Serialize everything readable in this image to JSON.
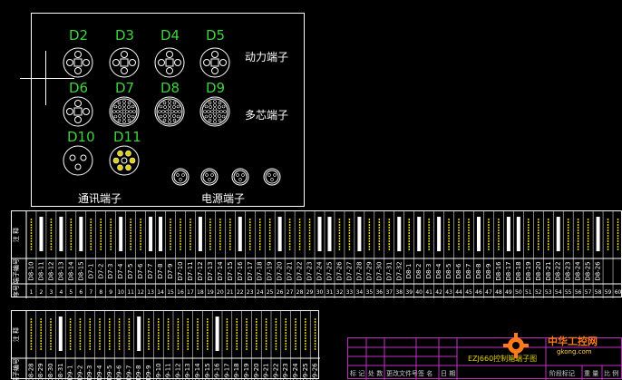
{
  "connectors": {
    "power_group": [
      "D2",
      "D3",
      "D4",
      "D5"
    ],
    "multi_group": [
      "D6",
      "D7",
      "D8",
      "D9"
    ],
    "comm_group": [
      "D10",
      "D11"
    ]
  },
  "labels": {
    "power_terminal": "动力端子",
    "multicore_terminal": "多芯端子",
    "comm_terminal": "通讯端子",
    "power_supply_terminal": "电源端子"
  },
  "strip1": {
    "row_headers": [
      "注 释",
      "端子编号",
      "序号"
    ],
    "first_numbers": [
      "1",
      "2",
      "3",
      "4",
      "5",
      "6",
      "7",
      "8",
      "9",
      "10",
      "11",
      "12",
      "13",
      "14",
      "15",
      "16",
      "17",
      "18",
      "19",
      "20",
      "21",
      "22",
      "23",
      "24",
      "25",
      "26",
      "27",
      "28",
      "29",
      "30",
      "31",
      "32",
      "33",
      "34",
      "35",
      "36",
      "37",
      "38",
      "39",
      "40",
      "41",
      "42",
      "43",
      "44",
      "45",
      "46",
      "47",
      "48",
      "49",
      "50",
      "51",
      "52",
      "53",
      "54",
      "55",
      "56",
      "57",
      "58",
      "59",
      "60",
      "61"
    ],
    "terminal_ids": [
      "D8-10",
      "D8-11",
      "D8-12",
      "D8-13",
      "D8-14",
      "D8-15",
      "D7-1",
      "D7-2",
      "D7-3",
      "D7-4",
      "D7-5",
      "D7-6",
      "D7-7",
      "D7-8",
      "D7-9",
      "D7-10",
      "D7-11",
      "D7-12",
      "D7-13",
      "D7-14",
      "D7-15",
      "D7-16",
      "D7-17",
      "D7-18",
      "D7-19",
      "D7-20",
      "D7-21",
      "D7-22",
      "D7-23",
      "D7-24",
      "D7-25",
      "D7-26",
      "D7-27",
      "D7-28",
      "D7-29",
      "D7-30",
      "D7-31",
      "D7-32",
      "D8-1",
      "D8-2",
      "D8-3",
      "D8-4",
      "D8-5",
      "D8-6",
      "D8-7",
      "D8-8",
      "D8-9",
      "D8-16",
      "D8-17",
      "D8-18",
      "D8-19",
      "D8-20",
      "D8-21",
      "D8-22",
      "D8-23",
      "D8-24",
      "D8-25",
      "D8-26"
    ]
  },
  "strip2": {
    "row_headers": [
      "注 释",
      "端子编号"
    ],
    "terminal_ids": [
      "D8-28",
      "D8-29",
      "D8-30",
      "D8-31",
      "D9-1",
      "D9-2",
      "D9-3",
      "D9-4",
      "D9-5",
      "D9-6",
      "D9-7",
      "D9-8",
      "D9-9",
      "D9-10",
      "D9-11",
      "D9-12",
      "D9-13",
      "D9-14",
      "D9-15",
      "D9-16",
      "D9-17",
      "D9-18",
      "D9-19",
      "D9-20",
      "D9-21",
      "D9-22",
      "D9-23",
      "D9-24",
      "D9-25",
      "D9-26"
    ]
  },
  "title_block": {
    "drawing_title": "EZJ660控制箱端子图",
    "row1": [
      "标 记",
      "处 数",
      "更改文件号",
      "签 名",
      "日 期"
    ],
    "right_cells": [
      "阶段标记",
      "重 量",
      "比 例"
    ]
  },
  "watermark": {
    "name": "中华工控网",
    "url": "gkong.com"
  },
  "colors": {
    "background": "#000000",
    "connector_label": "#3fd13f",
    "title_block_border": "#c030c0",
    "watermark": "#ff7a1a"
  }
}
